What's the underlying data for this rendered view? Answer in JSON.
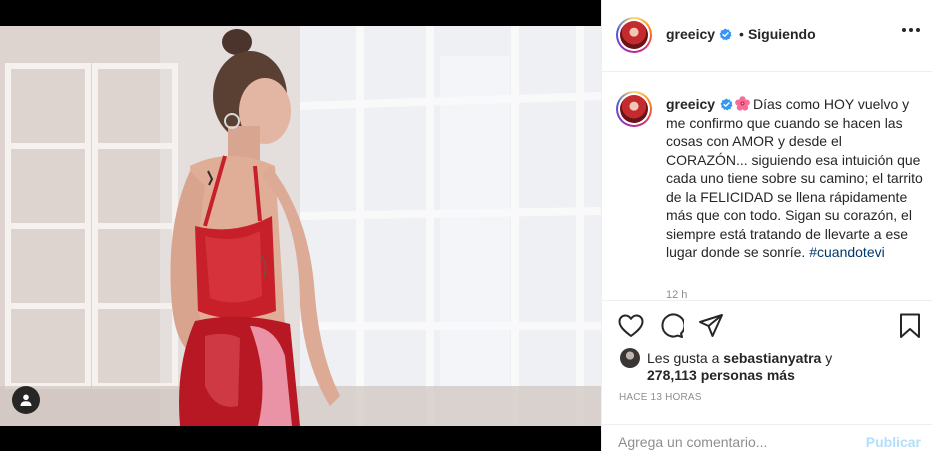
{
  "post": {
    "username": "greeicy",
    "follow_status": "Siguiendo",
    "dot": "•",
    "caption_username": "greeicy",
    "caption_text": "Días como HOY vuelvo y me confirmo que cuando se hacen las cosas con AMOR y desde el CORAZÓN... siguiendo esa intuición que cada uno tiene sobre su camino; el tarrito de la FELICIDAD se llena rápidamente más que con todo. Sigan su corazón, el siempre está tratando de llevarte a ese lugar donde se sonríe. ",
    "hashtag": "#cuandotevi",
    "caption_time": "12 h",
    "likes_prefix": "Les gusta a ",
    "likes_user": "sebastianyatra",
    "likes_suffix": " y",
    "likes_others": "278,113 personas más",
    "post_time": "HACE 13 HORAS"
  },
  "comment": {
    "placeholder": "Agrega un comentario...",
    "post_label": "Publicar"
  },
  "colors": {
    "verified": "#3897f0",
    "link": "#00376b",
    "publish_disabled": "#b2dffc"
  },
  "icons": {
    "verified": "verified-badge-icon",
    "more": "more-options-icon",
    "like": "heart-icon",
    "comment": "comment-icon",
    "share": "share-icon",
    "save": "bookmark-icon",
    "tag": "user-tag-icon",
    "emoji": "hibiscus-emoji-icon"
  }
}
